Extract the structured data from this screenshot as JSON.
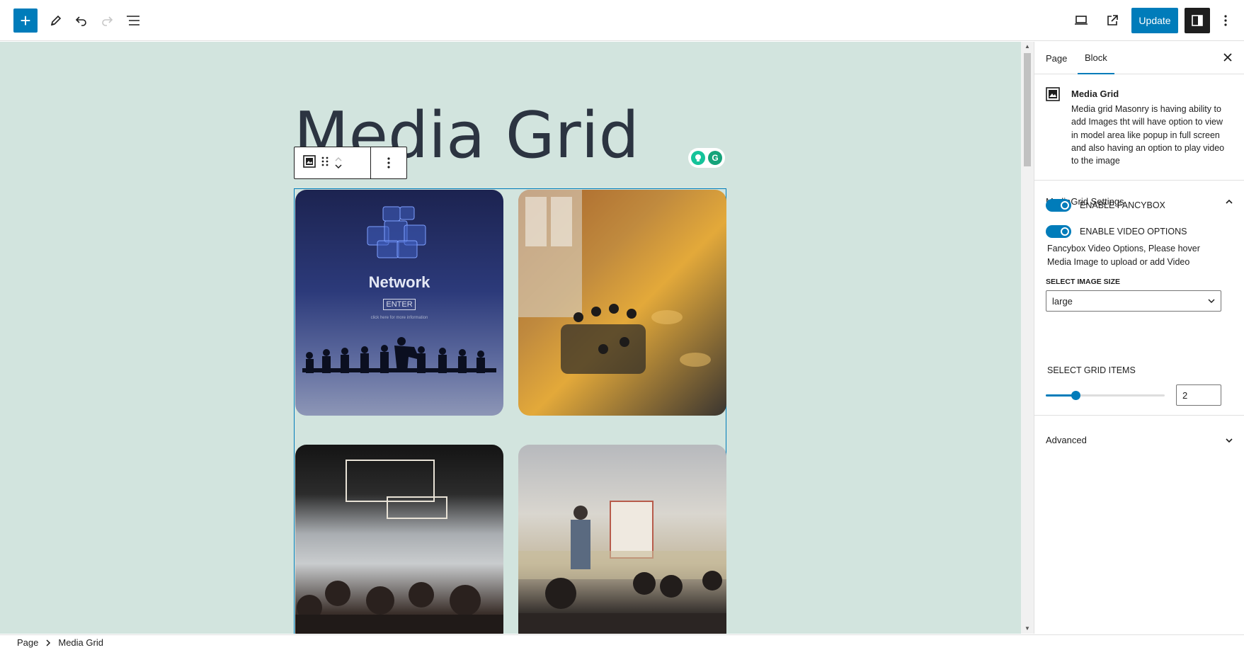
{
  "header": {
    "add_label": "+",
    "update_label": "Update"
  },
  "page": {
    "title": "Media Grid"
  },
  "grid": {
    "tile1_title": "Network",
    "tile1_button": "ENTER",
    "tile1_sub": "click here for more information"
  },
  "breadcrumb": {
    "items": [
      "Page",
      "Media Grid"
    ]
  },
  "sidebar": {
    "tabs": [
      "Page",
      "Block"
    ],
    "block_title": "Media Grid",
    "block_desc": "Media grid Masonry is having ability to add Images tht will have option to view in model area like popup in full screen and also having an option to play video to the image",
    "panel_title": "MediaGrid Settings",
    "toggle1": "ENABLE FANCYBOX",
    "toggle2": "ENABLE VIDEO OPTIONS",
    "help": "Fancybox Video Options, Please hover Media Image to upload or add Video",
    "size_label": "SELECT IMAGE SIZE",
    "size_value": "large",
    "grid_label": "SELECT GRID ITEMS",
    "grid_value": "2",
    "grid_fraction": 0.25,
    "advanced": "Advanced"
  },
  "colors": {
    "accent": "#007cba",
    "canvas": "#d2e4de"
  }
}
